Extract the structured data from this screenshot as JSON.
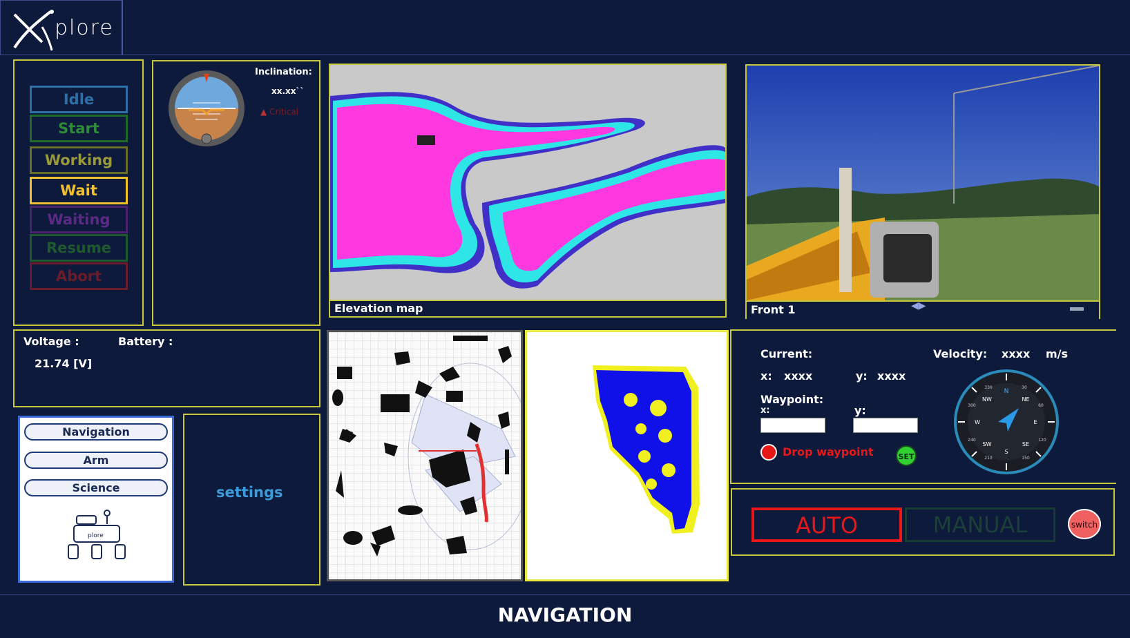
{
  "header": {
    "logo_text": "plore"
  },
  "states": {
    "items": [
      {
        "label": "Idle",
        "color": "#2e6fa8",
        "border": "#2e6fa8",
        "bg": "#0e1a3c"
      },
      {
        "label": "Start",
        "color": "#2f8a3a",
        "border": "#1f6b2c",
        "bg": "#0e1a3c"
      },
      {
        "label": "Working",
        "color": "#9a9a3a",
        "border": "#6d6d2a",
        "bg": "#0e1a3c"
      },
      {
        "label": "Wait",
        "color": "#f2c02c",
        "border": "#f2c02c",
        "bg": "#0e1a3c"
      },
      {
        "label": "Waiting",
        "color": "#5a2a86",
        "border": "#4a2270",
        "bg": "#0e1a3c"
      },
      {
        "label": "Resume",
        "color": "#1f5a2e",
        "border": "#1f5a2e",
        "bg": "#0e1a3c"
      },
      {
        "label": "Abort",
        "color": "#6a1c2a",
        "border": "#6a1c2a",
        "bg": "#0e1a3c"
      }
    ]
  },
  "inclination": {
    "label": "Inclination:",
    "value": "xx.xx``",
    "warning": "Critical"
  },
  "elevation": {
    "caption": "Elevation map"
  },
  "camera": {
    "caption": "Front 1"
  },
  "power": {
    "voltage_label": "Voltage :",
    "voltage_value": "21.74 [V]",
    "battery_label": "Battery :"
  },
  "nav_menu": {
    "navigation": "Navigation",
    "arm": "Arm",
    "science": "Science",
    "logo_text": "plore"
  },
  "settings": {
    "label": "settings"
  },
  "position": {
    "current_label": "Current:",
    "x_label": "x:",
    "x_value": "xxxx",
    "y_label": "y:",
    "y_value": "xxxx",
    "velocity_label": "Velocity:",
    "velocity_value": "xxxx",
    "velocity_unit": "m/s",
    "waypoint_label": "Waypoint:",
    "wp_x_label": "x:",
    "wp_y_label": "y:",
    "drop_label": "Drop waypoint",
    "set_label": "SET"
  },
  "compass": {
    "north": "N",
    "ne": "NE",
    "e": "E",
    "se": "SE",
    "s": "S",
    "sw": "SW",
    "w": "W",
    "nw": "NW",
    "ticks": [
      "30",
      "60",
      "120",
      "150",
      "210",
      "240",
      "300",
      "330"
    ]
  },
  "mode": {
    "auto": "AUTO",
    "manual": "MANUAL",
    "switch": "switch"
  },
  "footer": {
    "title": "NAVIGATION"
  }
}
